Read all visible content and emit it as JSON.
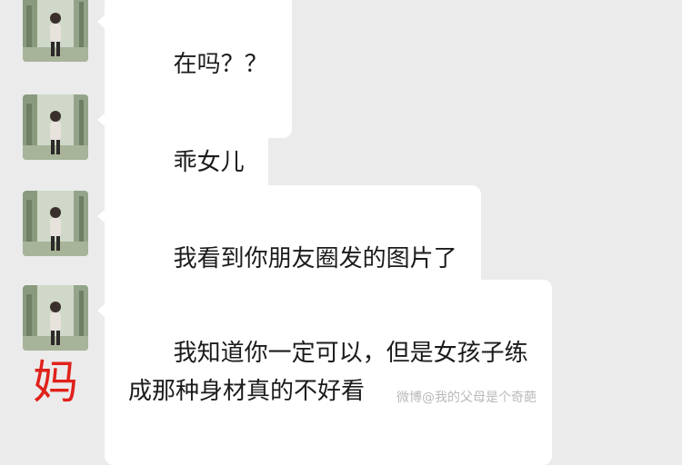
{
  "messages": [
    {
      "text": "在吗？？",
      "avatar_icon": "user-avatar-photo"
    },
    {
      "text": "乖女儿",
      "avatar_icon": "user-avatar-photo"
    },
    {
      "text": "我看到你朋友圈发的图片了",
      "avatar_icon": "user-avatar-photo"
    },
    {
      "text": "我知道你一定可以，但是女孩子练\n成那种身材真的不好看",
      "avatar_icon": "user-avatar-photo"
    }
  ],
  "sender_label": "妈",
  "watermark": "微博@我的父母是个奇葩",
  "colors": {
    "background": "#ebebeb",
    "bubble": "#ffffff",
    "sender_label": "#e0221b",
    "watermark": "#b9b9b9"
  }
}
